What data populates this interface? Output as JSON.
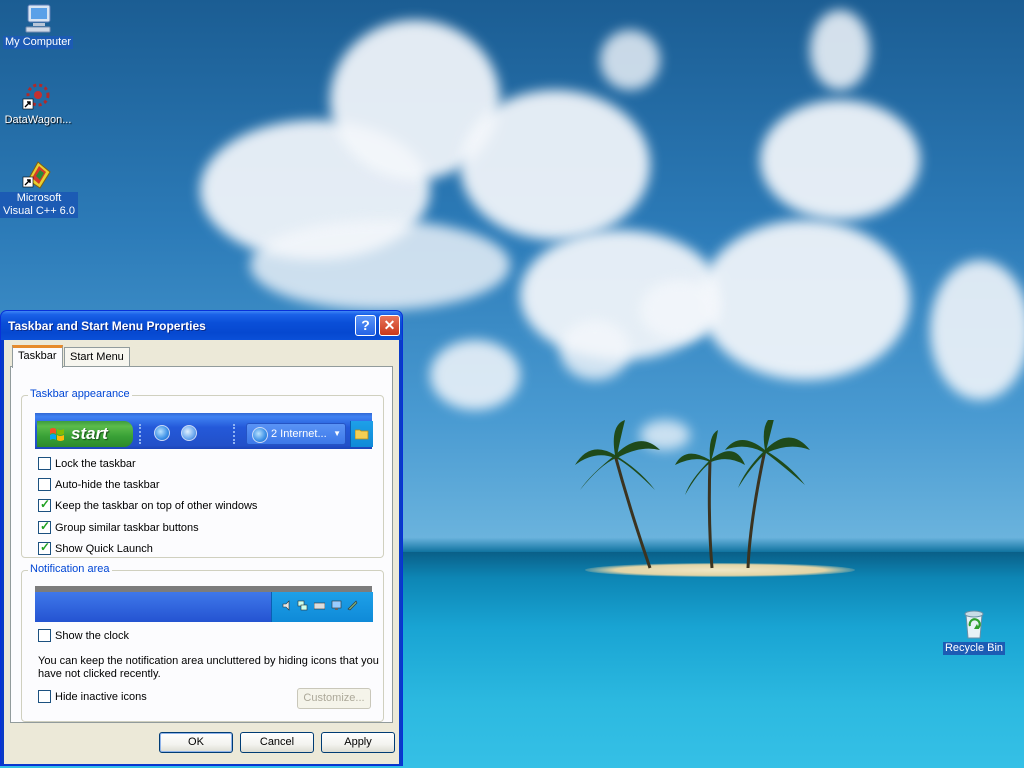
{
  "desktop": {
    "icons": [
      {
        "label": "My Computer",
        "icon": "my-computer-icon"
      },
      {
        "label": "DataWagon...",
        "icon": "datawagon-shortcut-icon"
      },
      {
        "label": "Microsoft Visual C++ 6.0",
        "icon": "visual-cpp-shortcut-icon"
      },
      {
        "label": "Recycle Bin",
        "icon": "recycle-bin-icon"
      }
    ]
  },
  "dialog": {
    "title": "Taskbar and Start Menu Properties",
    "help_label": "?",
    "close_label": "✕",
    "tabs": [
      {
        "label": "Taskbar",
        "active": true
      },
      {
        "label": "Start Menu",
        "active": false
      }
    ],
    "taskbar_appearance": {
      "title": "Taskbar appearance",
      "preview": {
        "start_label": "start",
        "task_button_label": "2 Internet..."
      },
      "options": [
        {
          "label": "Lock the taskbar",
          "checked": false
        },
        {
          "label": "Auto-hide the taskbar",
          "checked": false
        },
        {
          "label": "Keep the taskbar on top of other windows",
          "checked": true
        },
        {
          "label": "Group similar taskbar buttons",
          "checked": true
        },
        {
          "label": "Show Quick Launch",
          "checked": true
        }
      ]
    },
    "notification_area": {
      "title": "Notification area",
      "show_clock": {
        "label": "Show the clock",
        "checked": false
      },
      "description": "You can keep the notification area uncluttered by hiding icons that you have not clicked recently.",
      "hide_inactive": {
        "label": "Hide inactive icons",
        "checked": false
      },
      "customize_label": "Customize..."
    },
    "buttons": {
      "ok": "OK",
      "cancel": "Cancel",
      "apply": "Apply"
    }
  },
  "colors": {
    "check_mark": "#21a121",
    "group_title": "#0046d5",
    "title_bar": "#0a4fd8"
  }
}
